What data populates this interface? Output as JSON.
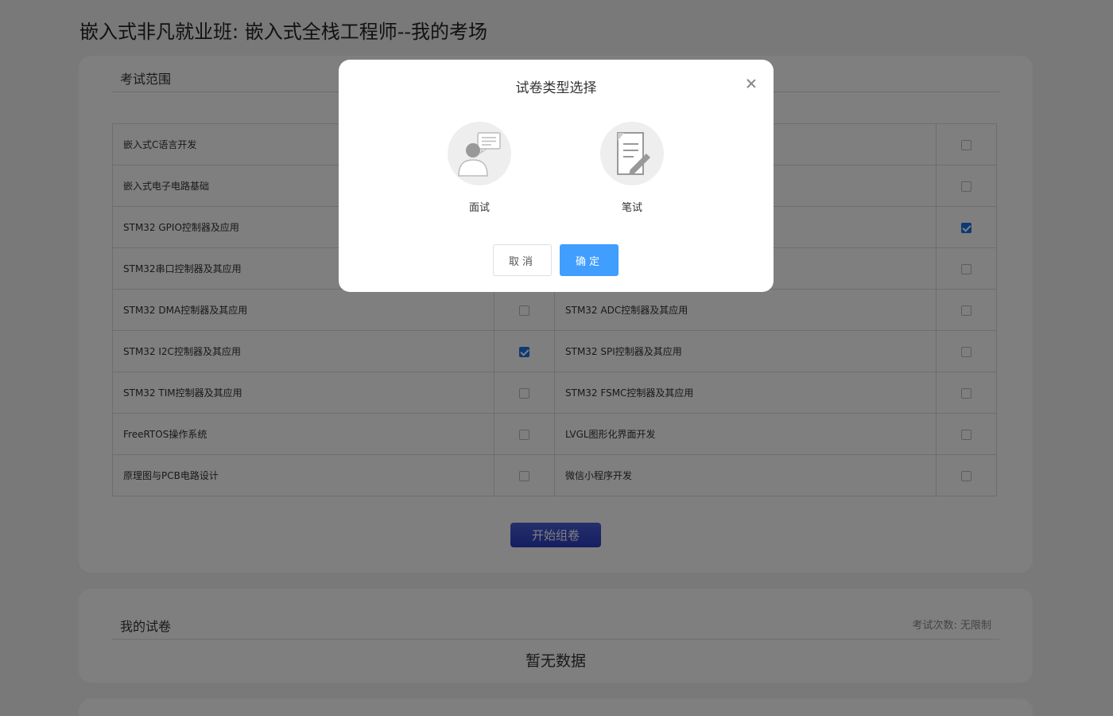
{
  "page": {
    "title": "嵌入式非凡就业班: 嵌入式全栈工程师--我的考场"
  },
  "scope": {
    "heading": "考试范围",
    "rows": [
      {
        "left": "嵌入式C语言开发",
        "left_checked": false,
        "right": "",
        "right_checked": false
      },
      {
        "left": "嵌入式电子电路基础",
        "left_checked": false,
        "right": "",
        "right_checked": false
      },
      {
        "left": "STM32 GPIO控制器及应用",
        "left_checked": false,
        "right": "",
        "right_checked": true
      },
      {
        "left": "STM32串口控制器及其应用",
        "left_checked": false,
        "right": "",
        "right_checked": false
      },
      {
        "left": "STM32 DMA控制器及其应用",
        "left_checked": false,
        "right": "STM32 ADC控制器及其应用",
        "right_checked": false
      },
      {
        "left": "STM32 I2C控制器及其应用",
        "left_checked": true,
        "right": "STM32 SPI控制器及其应用",
        "right_checked": false
      },
      {
        "left": "STM32 TIM控制器及其应用",
        "left_checked": false,
        "right": "STM32 FSMC控制器及其应用",
        "right_checked": false
      },
      {
        "left": "FreeRTOS操作系统",
        "left_checked": false,
        "right": "LVGL图形化界面开发",
        "right_checked": false
      },
      {
        "left": "原理图与PCB电路设计",
        "left_checked": false,
        "right": "微信小程序开发",
        "right_checked": false
      }
    ],
    "start_button": "开始组卷"
  },
  "papers": {
    "heading": "我的试卷",
    "attempts": "考试次数: 无限制",
    "empty": "暂无数据"
  },
  "modal": {
    "title": "试卷类型选择",
    "options": [
      {
        "label": "面试",
        "icon": "interview-icon"
      },
      {
        "label": "笔试",
        "icon": "written-exam-icon"
      }
    ],
    "cancel": "取消",
    "confirm": "确定"
  },
  "colors": {
    "primary": "#409eff",
    "start_button": "#2b3cc0",
    "checkbox_checked": "#1a73e8"
  }
}
